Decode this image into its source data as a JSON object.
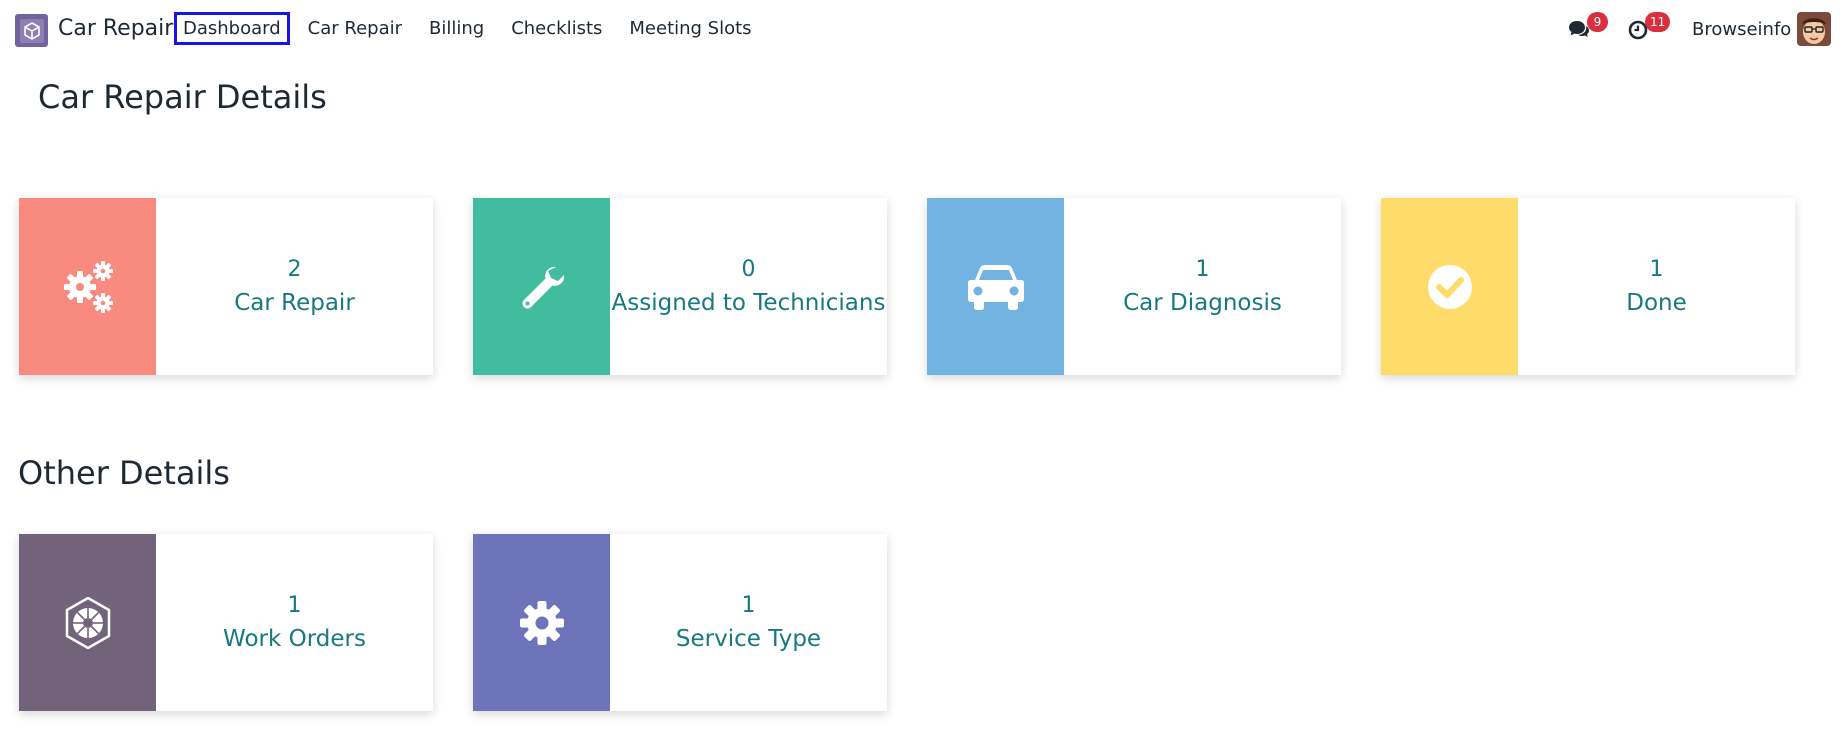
{
  "navbar": {
    "app_name": "Car Repair",
    "menu": [
      {
        "label": "Dashboard",
        "active": true
      },
      {
        "label": "Car Repair"
      },
      {
        "label": "Billing"
      },
      {
        "label": "Checklists"
      },
      {
        "label": "Meeting Slots"
      }
    ],
    "messages_count": "9",
    "activities_count": "11",
    "user_name": "Browseinfo"
  },
  "sections": {
    "car_repair_details": {
      "title": "Car Repair Details",
      "cards": [
        {
          "count": "2",
          "label": "Car Repair",
          "icon": "gears-icon",
          "color": "#f88a80"
        },
        {
          "count": "0",
          "label": "Assigned to Technicians",
          "icon": "wrench-icon",
          "color": "#42bc9f"
        },
        {
          "count": "1",
          "label": "Car Diagnosis",
          "icon": "car-icon",
          "color": "#72b3e2"
        },
        {
          "count": "1",
          "label": "Done",
          "icon": "check-circle-icon",
          "color": "#ffdb6a"
        }
      ]
    },
    "other_details": {
      "title": "Other Details",
      "cards": [
        {
          "count": "1",
          "label": "Work Orders",
          "icon": "emblem-icon",
          "color": "#72637b"
        },
        {
          "count": "1",
          "label": "Service Type",
          "icon": "gear-icon",
          "color": "#6d74b9"
        }
      ]
    }
  }
}
